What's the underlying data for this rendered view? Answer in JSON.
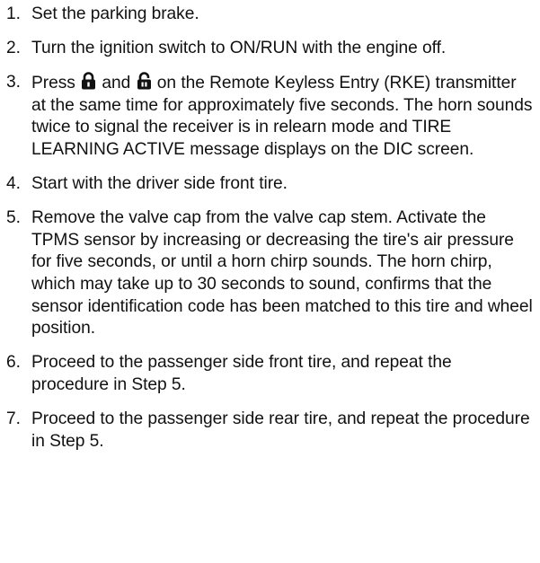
{
  "steps": [
    {
      "number": "1.",
      "text": "Set the parking brake."
    },
    {
      "number": "2.",
      "text": "Turn the ignition switch to ON/RUN with the engine off."
    },
    {
      "number": "3.",
      "text_before": "Press",
      "text_and": "and",
      "text_after": "on the Remote Keyless Entry (RKE) transmitter at the same time for approximately five seconds. The horn sounds twice to signal the receiver is in relearn mode and TIRE LEARNING ACTIVE message displays on the DIC screen.",
      "icons": [
        "lock-icon",
        "unlock-icon"
      ]
    },
    {
      "number": "4.",
      "text": "Start with the driver side front tire."
    },
    {
      "number": "5.",
      "text": "Remove the valve cap from the valve cap stem. Activate the TPMS sensor by increasing or decreasing the tire's air pressure for five seconds, or until a horn chirp sounds. The horn chirp, which may take up to 30 seconds to sound, confirms that the sensor identification code has been matched to this tire and wheel position."
    },
    {
      "number": "6.",
      "text": "Proceed to the passenger side front tire, and repeat the procedure in Step 5."
    },
    {
      "number": "7.",
      "text": "Proceed to the passenger side rear tire, and repeat the procedure in Step 5."
    }
  ]
}
